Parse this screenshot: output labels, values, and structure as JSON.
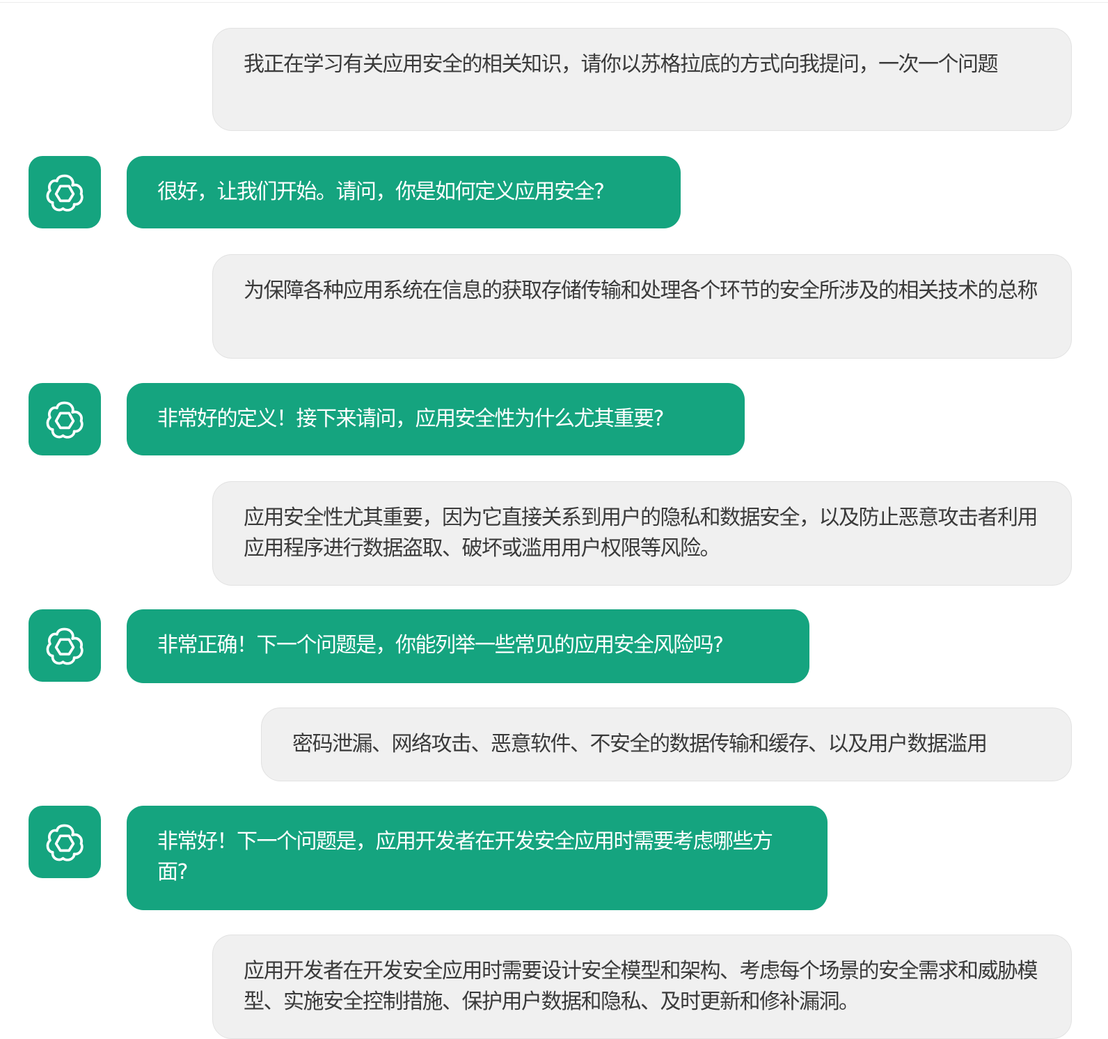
{
  "conversation": {
    "messages": [
      {
        "role": "user",
        "text": "我正在学习有关应用安全的相关知识，请你以苏格拉底的方式向我提问，一次一个问题"
      },
      {
        "role": "assistant",
        "avatar_icon": "openai-logo-icon",
        "text": "很好，让我们开始。请问，你是如何定义应用安全?"
      },
      {
        "role": "user",
        "text": "为保障各种应用系统在信息的获取存储传输和处理各个环节的安全所涉及的相关技术的总称"
      },
      {
        "role": "assistant",
        "avatar_icon": "openai-logo-icon",
        "text": "非常好的定义！接下来请问，应用安全性为什么尤其重要?"
      },
      {
        "role": "user",
        "text": "应用安全性尤其重要，因为它直接关系到用户的隐私和数据安全，以及防止恶意攻击者利用应用程序进行数据盗取、破坏或滥用用户权限等风险。"
      },
      {
        "role": "assistant",
        "avatar_icon": "openai-logo-icon",
        "text": "非常正确！下一个问题是，你能列举一些常见的应用安全风险吗?"
      },
      {
        "role": "user",
        "text": "密码泄漏、网络攻击、恶意软件、不安全的数据传输和缓存、以及用户数据滥用"
      },
      {
        "role": "assistant",
        "avatar_icon": "openai-logo-icon",
        "text": "非常好！下一个问题是，应用开发者在开发安全应用时需要考虑哪些方面?"
      },
      {
        "role": "user",
        "text": "应用开发者在开发安全应用时需要设计安全模型和架构、考虑每个场景的安全需求和威胁模型、实施安全控制措施、保护用户数据和隐私、及时更新和修补漏洞。"
      }
    ]
  },
  "colors": {
    "assistant_bubble": "#15a47f",
    "user_bubble": "#f0f0f0",
    "user_text": "#3a3a3a",
    "assistant_text": "#ffffff"
  }
}
